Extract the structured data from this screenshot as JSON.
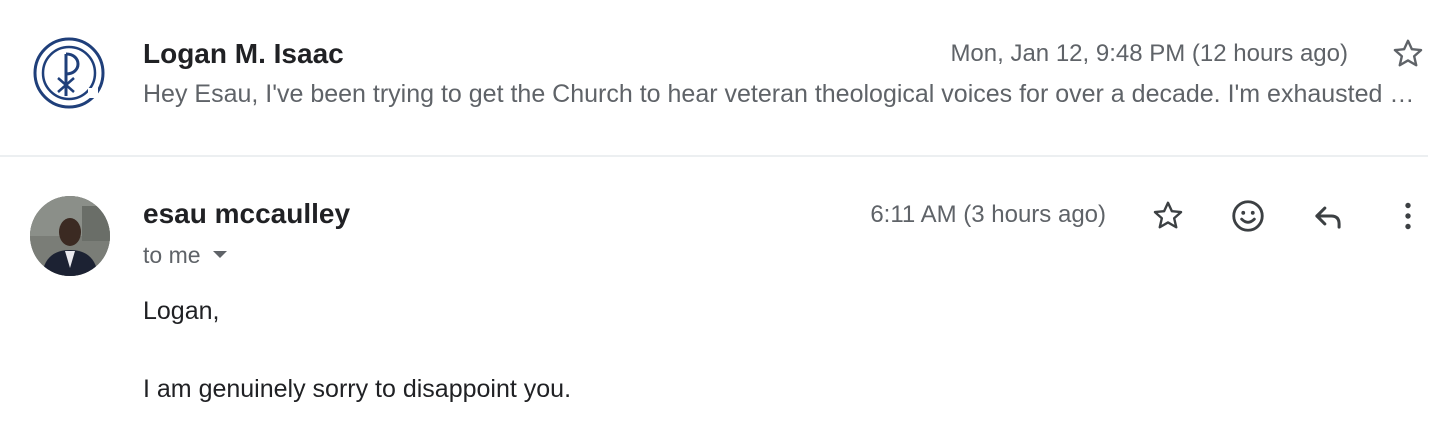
{
  "thread": {
    "collapsed_message": {
      "sender": "Logan M. Isaac",
      "date": "Mon, Jan 12, 9:48 PM (12 hours ago)",
      "snippet": "Hey Esau, I've been trying to get the Church to hear veteran theological voices for over a decade. I'm exhausted and disappointed",
      "avatar_icon": "chi-rho-logo-icon",
      "star_icon": "star-outline-icon"
    },
    "expanded_message": {
      "sender": "esau mccaulley",
      "recipients_label": "to me",
      "date": "6:11 AM (3 hours ago)",
      "greeting": "Logan,",
      "body_line_1": "I am genuinely sorry to disappoint you.",
      "actions": {
        "star_icon": "star-outline-icon",
        "emoji_icon": "add-reaction-icon",
        "reply_icon": "reply-icon",
        "more_icon": "more-vert-icon"
      }
    }
  },
  "colors": {
    "text_primary": "#202124",
    "text_secondary": "#5f6368",
    "logo_blue": "#1f3f7a",
    "divider": "#eceff1"
  }
}
